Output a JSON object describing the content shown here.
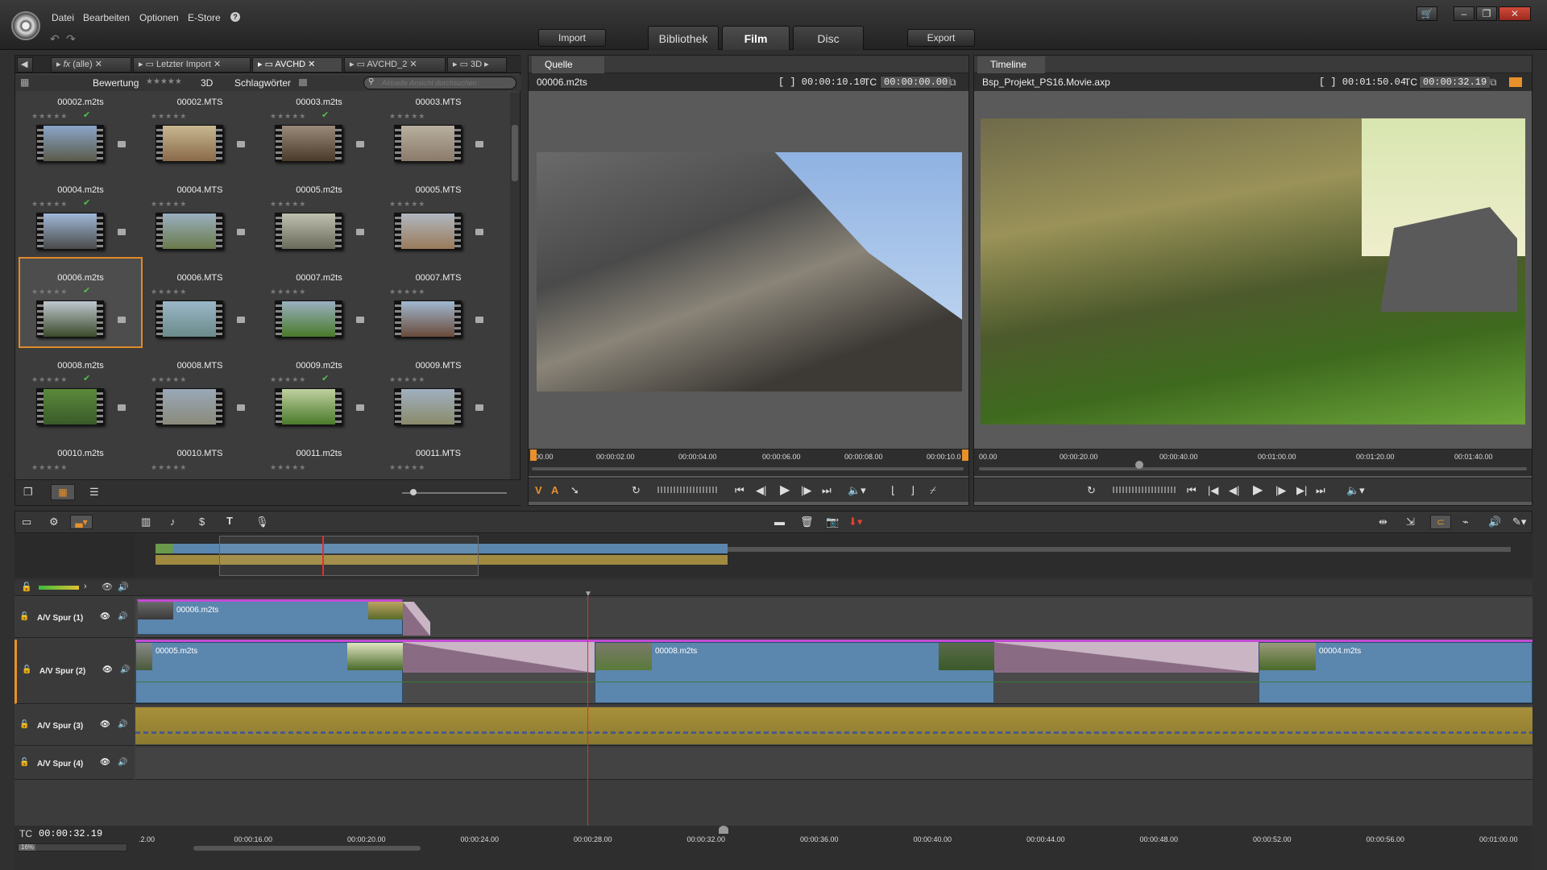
{
  "menu": [
    "Datei",
    "Bearbeiten",
    "Optionen",
    "E-Store",
    "?"
  ],
  "top_buttons": {
    "import": "Import",
    "export": "Export"
  },
  "main_tabs": [
    "Bibliothek",
    "Film",
    "Disc"
  ],
  "active_tab": "Film",
  "window_controls": [
    "cart-icon",
    "minimize-icon",
    "restore-icon",
    "maximize-icon",
    "close-icon"
  ],
  "library": {
    "tabs": [
      "(alle)",
      "Letzter Import",
      "AVCHD",
      "AVCHD_2",
      "3D"
    ],
    "active_tab": "AVCHD",
    "rating_label": "Bewertung",
    "label_3d": "3D",
    "tags_label": "Schlagwörter",
    "search_placeholder": "Aktuelle Ansicht durchsuchen",
    "items": [
      {
        "name": "00002.m2ts",
        "check": true
      },
      {
        "name": "00002.MTS",
        "check": false
      },
      {
        "name": "00003.m2ts",
        "check": true
      },
      {
        "name": "00003.MTS",
        "check": false
      },
      {
        "name": "00004.m2ts",
        "check": true
      },
      {
        "name": "00004.MTS",
        "check": false
      },
      {
        "name": "00005.m2ts",
        "check": false
      },
      {
        "name": "00005.MTS",
        "check": false
      },
      {
        "name": "00006.m2ts",
        "check": true
      },
      {
        "name": "00006.MTS",
        "check": false
      },
      {
        "name": "00007.m2ts",
        "check": false
      },
      {
        "name": "00007.MTS",
        "check": false
      },
      {
        "name": "00008.m2ts",
        "check": true
      },
      {
        "name": "00008.MTS",
        "check": false
      },
      {
        "name": "00009.m2ts",
        "check": true
      },
      {
        "name": "00009.MTS",
        "check": false
      },
      {
        "name": "00010.m2ts",
        "check": false
      },
      {
        "name": "00010.MTS",
        "check": false
      },
      {
        "name": "00011.m2ts",
        "check": false
      },
      {
        "name": "00011.MTS",
        "check": false
      }
    ],
    "selected": "00006.m2ts"
  },
  "source": {
    "tab": "Quelle",
    "file": "00006.m2ts",
    "duration": "[ ] 00:00:10.10",
    "tc_label": "TC",
    "tc": "00:00:00.00",
    "ruler": [
      "00.00",
      "00:00:02.00",
      "00:00:04.00",
      "00:00:06.00",
      "00:00:08.00",
      "00:00:10.0"
    ],
    "markers": [
      "V",
      "A"
    ]
  },
  "timeline_preview": {
    "tab": "Timeline",
    "file": "Bsp_Projekt_PS16.Movie.axp",
    "duration": "[ ] 00:01:50.04",
    "tc_label": "TC",
    "tc": "00:00:32.19",
    "ruler": [
      "00.00",
      "00:00:20.00",
      "00:00:40.00",
      "00:01:00.00",
      "00:01:20.00",
      "00:01:40.00"
    ]
  },
  "tracks": [
    {
      "name": "A/V Spur (1)",
      "clips": [
        "00006.m2ts"
      ]
    },
    {
      "name": "A/V Spur (2)",
      "clips": [
        "00005.m2ts",
        "00008.m2ts",
        "00004.m2ts"
      ]
    },
    {
      "name": "A/V Spur (3)",
      "clips": []
    },
    {
      "name": "A/V Spur (4)",
      "clips": []
    }
  ],
  "timecode": {
    "label": "TC",
    "value": "00:00:32.19"
  },
  "zoom": "16%",
  "timeline_ruler": [
    ".2.00",
    "00:00:16.00",
    "00:00:20.00",
    "00:00:24.00",
    "00:00:28.00",
    "00:00:32.00",
    "00:00:36.00",
    "00:00:40.00",
    "00:00:44.00",
    "00:00:48.00",
    "00:00:52.00",
    "00:00:56.00",
    "00:01:00.00"
  ]
}
